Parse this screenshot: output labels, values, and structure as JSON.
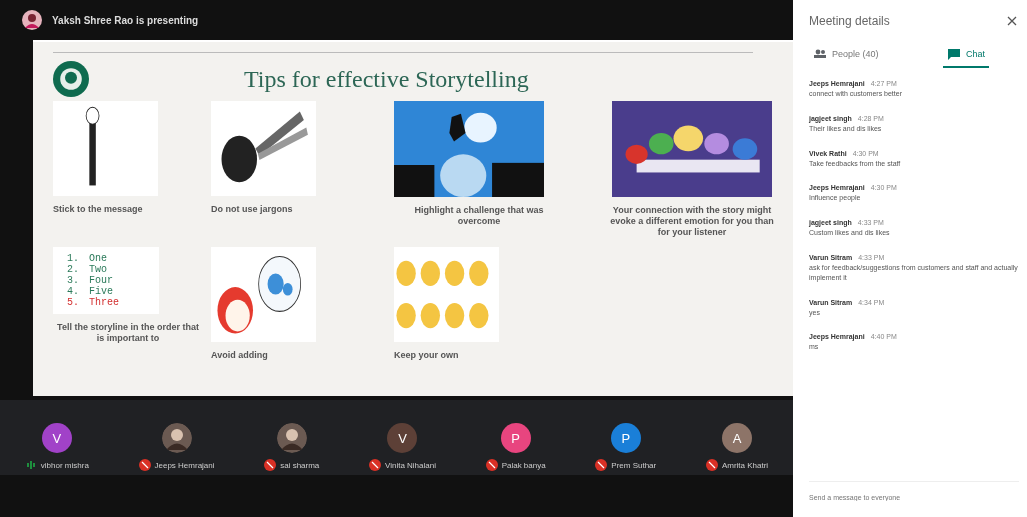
{
  "presenter": {
    "label": "Yaksh Shree Rao is presenting"
  },
  "slide": {
    "title": "Tips for effective Storytelling",
    "items": [
      {
        "kind": "picture",
        "caption": "Stick to the message"
      },
      {
        "kind": "picture",
        "caption": "Do not use jargons"
      },
      {
        "kind": "picture",
        "caption": "Highlight a challenge that was overcome"
      },
      {
        "kind": "picture",
        "caption": "Your connection with the story might evoke a different emotion for you than for your listener"
      },
      {
        "kind": "list",
        "lines": [
          {
            "num": "1.",
            "text": "One",
            "highlight": false
          },
          {
            "num": "2.",
            "text": "Two",
            "highlight": false
          },
          {
            "num": "3.",
            "text": "Four",
            "highlight": false
          },
          {
            "num": "4.",
            "text": "Five",
            "highlight": false
          },
          {
            "num": "5.",
            "text": "Three",
            "highlight": true
          }
        ],
        "caption": "Tell the storyline in the order that is important to"
      },
      {
        "kind": "picture",
        "caption": "Avoid adding"
      },
      {
        "kind": "picture",
        "caption": "Keep your own"
      }
    ]
  },
  "participants": [
    {
      "name": "vibhor mishra",
      "kind": "letter",
      "letter": "V",
      "color": "#a142c8",
      "muted": false
    },
    {
      "name": "Jeeps Hemrajani",
      "muted": true
    },
    {
      "name": "sai sharma",
      "muted": true
    },
    {
      "name": "Vinita Nihalani",
      "kind": "letter",
      "letter": "V",
      "color": "#5d4037",
      "muted": true
    },
    {
      "name": "Palak banya",
      "kind": "letter",
      "letter": "P",
      "color": "#e8457f",
      "muted": true
    },
    {
      "name": "Prem Suthar",
      "kind": "letter",
      "letter": "P",
      "color": "#1a7fd8",
      "muted": true
    },
    {
      "name": "Amrita Khatri",
      "kind": "letter",
      "letter": "A",
      "color": "#8d7468",
      "muted": true
    }
  ],
  "panel": {
    "title": "Meeting details",
    "tabs": [
      {
        "label": "People (40)",
        "selected": false
      },
      {
        "label": "Chat",
        "selected": true
      }
    ],
    "messages": [
      {
        "sender": "Jeeps Hemrajani",
        "time": "4:27 PM",
        "text": "connect with customers better"
      },
      {
        "sender": "jagjeet singh",
        "time": "4:28 PM",
        "text": "Their likes and dis likes"
      },
      {
        "sender": "Vivek Rathi",
        "time": "4:30 PM",
        "text": "Take feedbacks from the staff"
      },
      {
        "sender": "Jeeps Hemrajani",
        "time": "4:30 PM",
        "text": "Influence people"
      },
      {
        "sender": "jagjeet singh",
        "time": "4:33 PM",
        "text": "Custom likes and dis likes"
      },
      {
        "sender": "Varun Sitram",
        "time": "4:33 PM",
        "text": "ask for feedback/suggestions from customers and staff and actually implement it"
      },
      {
        "sender": "Varun Sitram",
        "time": "4:34 PM",
        "text": "yes"
      },
      {
        "sender": "Jeeps Hemrajani",
        "time": "4:40 PM",
        "text": "ms"
      }
    ],
    "input": {
      "placeholder": "Send a message to everyone"
    }
  }
}
